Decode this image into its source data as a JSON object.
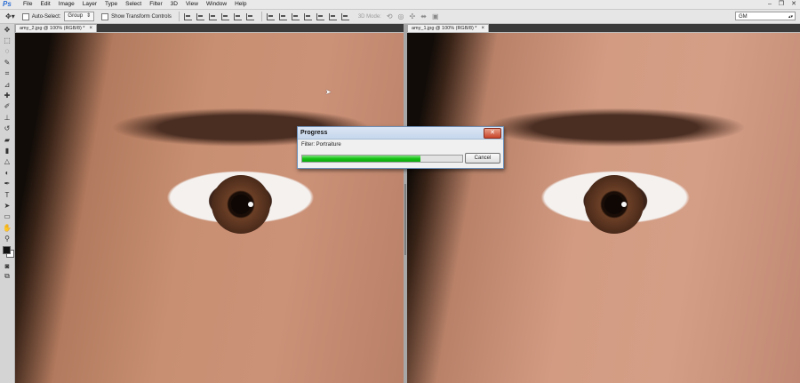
{
  "app": {
    "logo": "Ps"
  },
  "menu": [
    "File",
    "Edit",
    "Image",
    "Layer",
    "Type",
    "Select",
    "Filter",
    "3D",
    "View",
    "Window",
    "Help"
  ],
  "window_controls": {
    "minimize": "–",
    "restore": "❐",
    "close": "✕"
  },
  "options_bar": {
    "auto_select_label": "Auto-Select:",
    "auto_select_value": "Group",
    "show_transform_label": "Show Transform Controls",
    "mode_label": "3D Mode:",
    "workspace_value": "GM"
  },
  "documents": [
    {
      "tab_title": "amy_2.jpg @ 100% (RGB/8) *",
      "close": "×"
    },
    {
      "tab_title": "amy_1.jpg @ 100% (RGB/8) *",
      "close": "×"
    }
  ],
  "dialog": {
    "title": "Progress",
    "status": "Filter: Portraiture",
    "cancel_label": "Cancel",
    "close": "✕",
    "progress": 0.74
  },
  "colors": {
    "progress_fill": "#15c315",
    "ps_accent": "#2a6cd1"
  },
  "tools": [
    "move-tool",
    "marquee-tool",
    "lasso-tool",
    "quick-select-tool",
    "crop-tool",
    "eyedropper-tool",
    "healing-brush-tool",
    "brush-tool",
    "clone-stamp-tool",
    "history-brush-tool",
    "eraser-tool",
    "gradient-tool",
    "blur-tool",
    "dodge-tool",
    "pen-tool",
    "type-tool",
    "path-select-tool",
    "shape-tool",
    "hand-tool",
    "zoom-tool"
  ]
}
